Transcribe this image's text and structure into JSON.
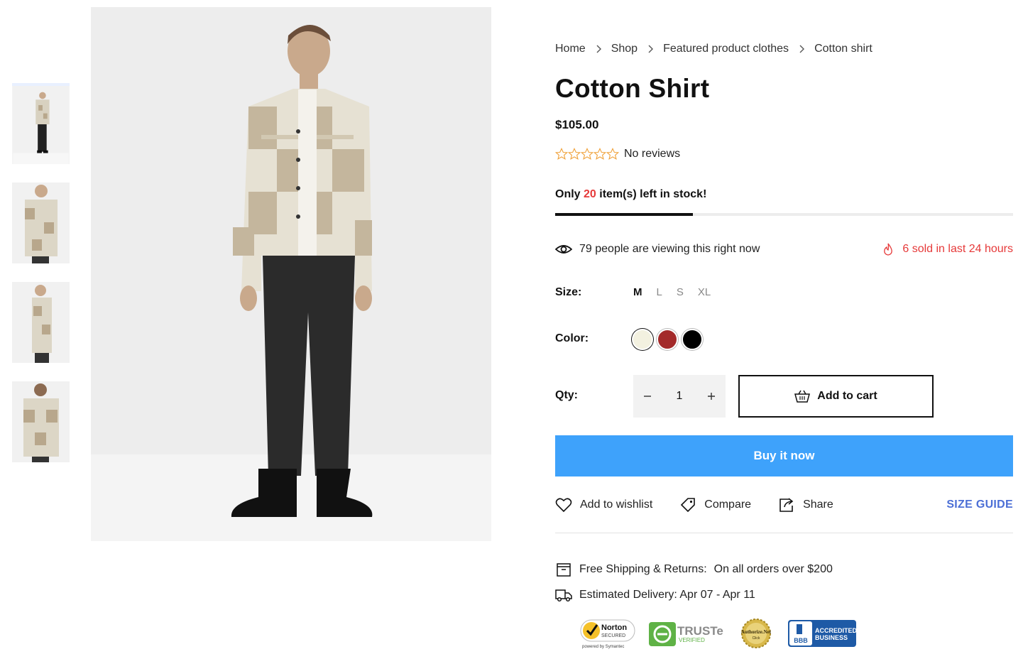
{
  "gallery": {
    "thumbnails": [
      {
        "alt": "front-full"
      },
      {
        "alt": "front-close"
      },
      {
        "alt": "side"
      },
      {
        "alt": "back"
      }
    ]
  },
  "breadcrumb": {
    "items": [
      "Home",
      "Shop",
      "Featured product clothes",
      "Cotton shirt"
    ]
  },
  "product": {
    "title": "Cotton Shirt",
    "price": "$105.00",
    "rating_stars": 0,
    "reviews_text": "No reviews"
  },
  "stock": {
    "prefix": "Only",
    "count": "20",
    "suffix": "item(s) left in stock!",
    "fill_fraction": 0.3
  },
  "social_proof": {
    "viewing": "79 people are viewing this right now",
    "sold": "6 sold in last 24 hours"
  },
  "options": {
    "size_label": "Size:",
    "sizes": [
      "M",
      "L",
      "S",
      "XL"
    ],
    "selected_size": "M",
    "color_label": "Color:",
    "colors": [
      "#f3f1e0",
      "#a32a2a",
      "#000000"
    ],
    "qty_label": "Qty:",
    "qty_value": "1"
  },
  "buttons": {
    "add_to_cart": "Add to cart",
    "buy_now": "Buy it now"
  },
  "actions": {
    "wishlist": "Add to wishlist",
    "compare": "Compare",
    "share": "Share",
    "size_guide": "SIZE GUIDE"
  },
  "shipping": {
    "free_label": "Free Shipping & Returns:",
    "free_value": "On all orders over $200",
    "delivery": "Estimated Delivery: Apr 07 - Apr 11"
  },
  "trust_badges": {
    "norton": {
      "title": "Norton",
      "sub": "SECURED",
      "powered": "powered by Symantec"
    },
    "truste": {
      "title": "TRUSTe",
      "sub": "VERIFIED"
    },
    "authorize": {
      "title": "Authorize.Net",
      "sub": "Click"
    },
    "bbb": {
      "logo": "BBB",
      "line1": "ACCREDITED",
      "line2": "BUSINESS"
    }
  },
  "colors": {
    "accent_blue": "#3ea2fb",
    "alert_red": "#e63939",
    "link_blue": "#4c6fd6",
    "star_orange": "#f0a23b"
  }
}
